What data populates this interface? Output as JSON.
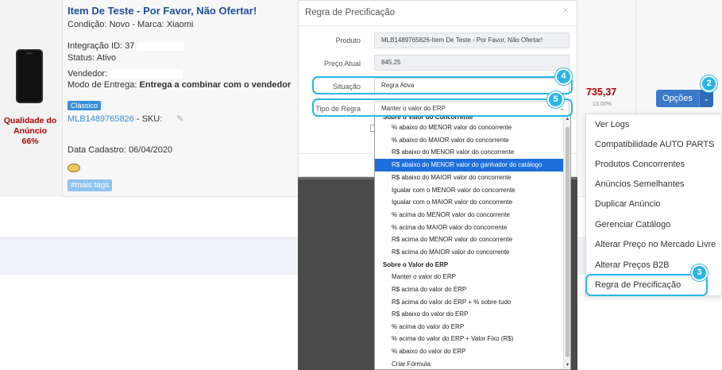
{
  "listing": {
    "title": "Item De Teste - Por Favor, Não Ofertar!",
    "condition": "Condição: Novo - Marca: Xiaomi",
    "integration_id": "Integração ID: 37",
    "status": "Status: Ativo",
    "seller": "Vendedor:",
    "delivery_label": "Modo de Entrega: ",
    "delivery_value": "Entrega a combinar com o vendedor",
    "listing_type": "Clássico",
    "mlb_code": "MLB1489765826",
    "sku_label": " - SKU:",
    "date": "Data Cadastro: 06/04/2020",
    "tags": "#mais tags",
    "quality_label": "Qualidade do Anúncio",
    "quality_value": "66%",
    "price": "735,37",
    "price_pct": "13.00%"
  },
  "options_button": {
    "label": "Opções",
    "caret": "⌄"
  },
  "menu": {
    "items": [
      "Ver Logs",
      "Compatibilidade AUTO PARTS",
      "Produtos Concorrentes",
      "Anúncios Semelhantes",
      "Duplicar Anúncio",
      "Gerenciar Catálogo",
      "Alterar Preço no Mercado Livre",
      "Alterar Preços B2B",
      "Regra de Precificação"
    ]
  },
  "modal": {
    "title": "Regra de Precificação",
    "close": "×",
    "fields": {
      "produto_label": "Produto",
      "produto_value": "MLB1489765826-Item De Teste - Por Favor, Não Ofertar!",
      "preco_label": "Preço Atual",
      "preco_value": "845.25",
      "situacao_label": "Situação",
      "situacao_value": "Regra Ativa",
      "tipo_label": "Tipo de Regra",
      "tipo_value": "Manter o valor do ERP"
    }
  },
  "dropdown": {
    "group_concorrente": "Sobre o Valor do Concorrente",
    "concorrente_options": [
      "% abaixo do MENOR valor do concorrente",
      "% abaixo do MAIOR valor do concorrente",
      "R$ abaixo do MENOR valor do concorrente",
      "R$ abaixo do MENOR valor do ganhador do catálogo",
      "R$ abaixo do MAIOR valor do concorrente",
      "Igualar com o MENOR valor do concorrente",
      "Igualar com o MAIOR valor do concorrente",
      "% acima do MENOR valor do concorrente",
      "% acima do MAIOR valor do concorrente",
      "R$ acima do MENOR valor do concorrente",
      "R$ acima do MAIOR valor do concorrente"
    ],
    "group_erp": "Sobre o Valor do ERP",
    "erp_options": [
      "Manter o valor do ERP",
      "R$ acima do valor do ERP",
      "R$ acima do valor do ERP + % sobre tudo",
      "R$ abaixo do valor do ERP",
      "% acima do valor do ERP",
      "% acima do valor do ERP + Valor Fixo (R$)",
      "% abaixo do valor do ERP",
      "Criar Fórmula"
    ]
  },
  "callouts": {
    "n2": "2",
    "n3": "3",
    "n4": "4",
    "n5": "5"
  },
  "colors": {
    "accent": "#29b6e6",
    "brand_blue": "#3b7ac9",
    "highlight": "#1e6fdb",
    "price_red": "#b30000"
  }
}
